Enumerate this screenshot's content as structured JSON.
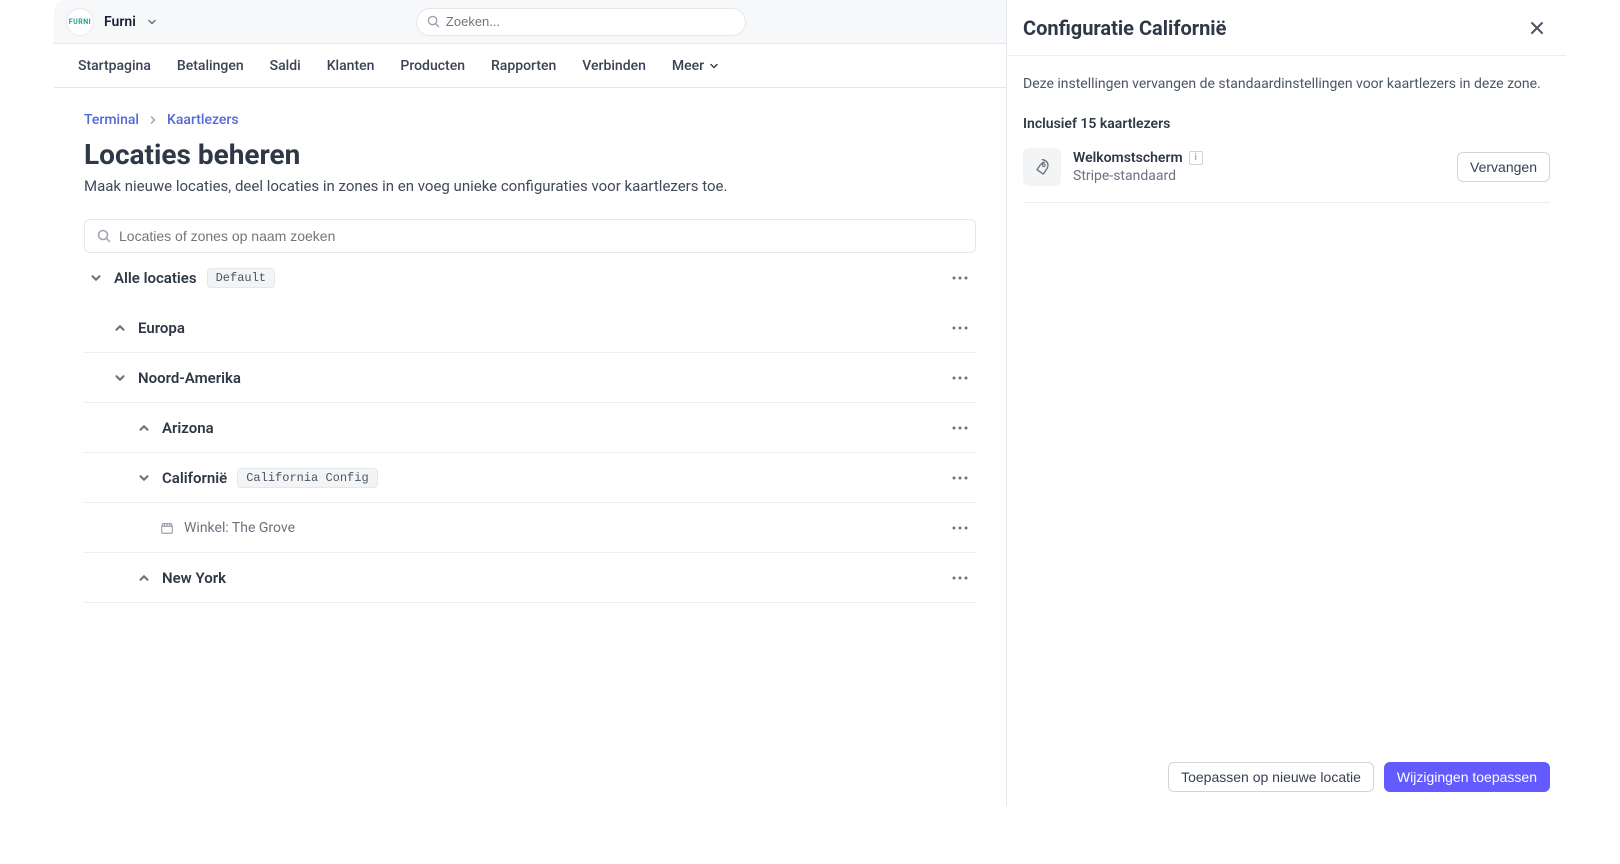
{
  "brand": {
    "logo_text": "FURNI",
    "name": "Furni"
  },
  "search": {
    "placeholder": "Zoeken..."
  },
  "nav": {
    "items": [
      "Startpagina",
      "Betalingen",
      "Saldi",
      "Klanten",
      "Producten",
      "Rapporten",
      "Verbinden",
      "Meer"
    ]
  },
  "breadcrumb": {
    "items": [
      "Terminal",
      "Kaartlezers"
    ]
  },
  "page": {
    "title": "Locaties beheren",
    "subtitle": "Maak nieuwe locaties, deel locaties in zones in en voeg unieke configuraties voor kaartlezers toe.",
    "search_placeholder": "Locaties of zones op naam zoeken"
  },
  "tree": {
    "root": {
      "label": "Alle locaties",
      "badge": "Default"
    },
    "europa": {
      "label": "Europa"
    },
    "na": {
      "label": "Noord-Amerika"
    },
    "arizona": {
      "label": "Arizona"
    },
    "california": {
      "label": "Californië",
      "badge": "California Config"
    },
    "store_grove": {
      "label": "Winkel: The Grove"
    },
    "ny": {
      "label": "New York"
    }
  },
  "panel": {
    "title": "Configuratie Californië",
    "description": "Deze instellingen vervangen de standaardinstellingen voor kaartlezers in deze zone.",
    "subheading": "Inclusief 15 kaartlezers",
    "config": {
      "title": "Welkomstscherm",
      "subtitle": "Stripe-standaard",
      "replace_label": "Vervangen"
    },
    "footer": {
      "apply_new": "Toepassen op nieuwe locatie",
      "apply_changes": "Wijzigingen toepassen"
    }
  }
}
